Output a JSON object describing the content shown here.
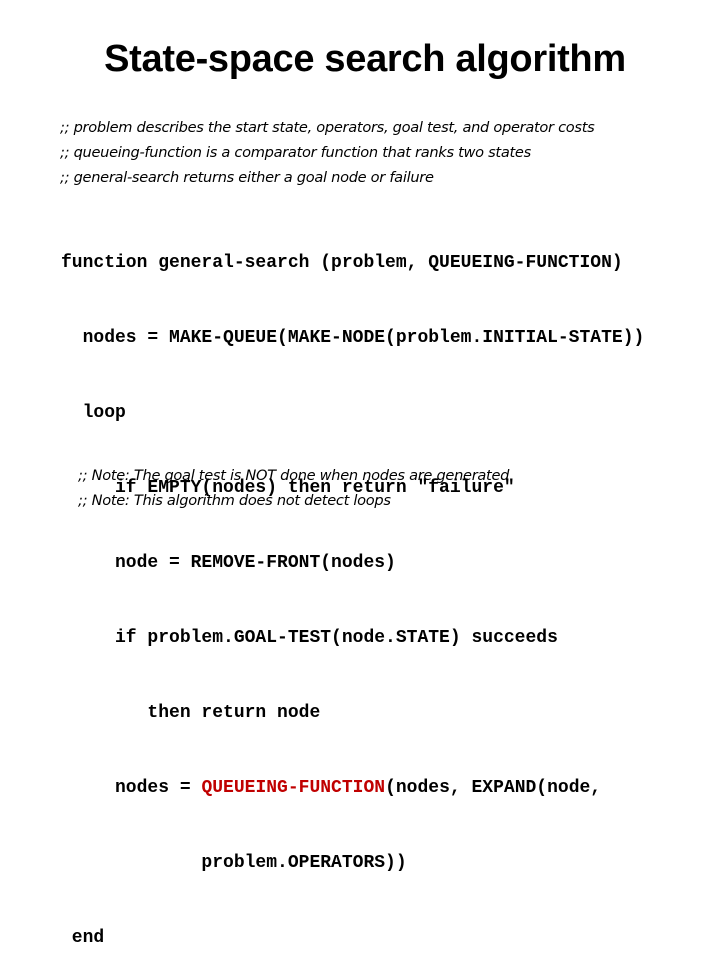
{
  "title": "State-space search algorithm",
  "header_comments": [
    ";; problem describes the start state, operators, goal test, and operator costs",
    ";; queueing-function is a comparator function that ranks two states",
    ";; general-search returns either a goal node or failure"
  ],
  "code": {
    "line1": "function general-search (problem, QUEUEING-FUNCTION)",
    "line2": "  nodes = MAKE-QUEUE(MAKE-NODE(problem.INITIAL-STATE))",
    "line3": "  loop",
    "line4": "     if EMPTY(nodes) then return \"failure\"",
    "line5": "     node = REMOVE-FRONT(nodes)",
    "line6": "     if problem.GOAL-TEST(node.STATE) succeeds",
    "line7": "        then return node",
    "line8_prefix": "     nodes = ",
    "line8_highlight": "QUEUEING-FUNCTION",
    "line8_suffix": "(nodes, EXPAND(node,",
    "line9": "             problem.OPERATORS))",
    "line10": " end"
  },
  "highlight_color": "#c00000",
  "notes": [
    ";; Note: The goal test is NOT done when nodes are generated",
    ";; Note: This algorithm does not detect loops"
  ]
}
